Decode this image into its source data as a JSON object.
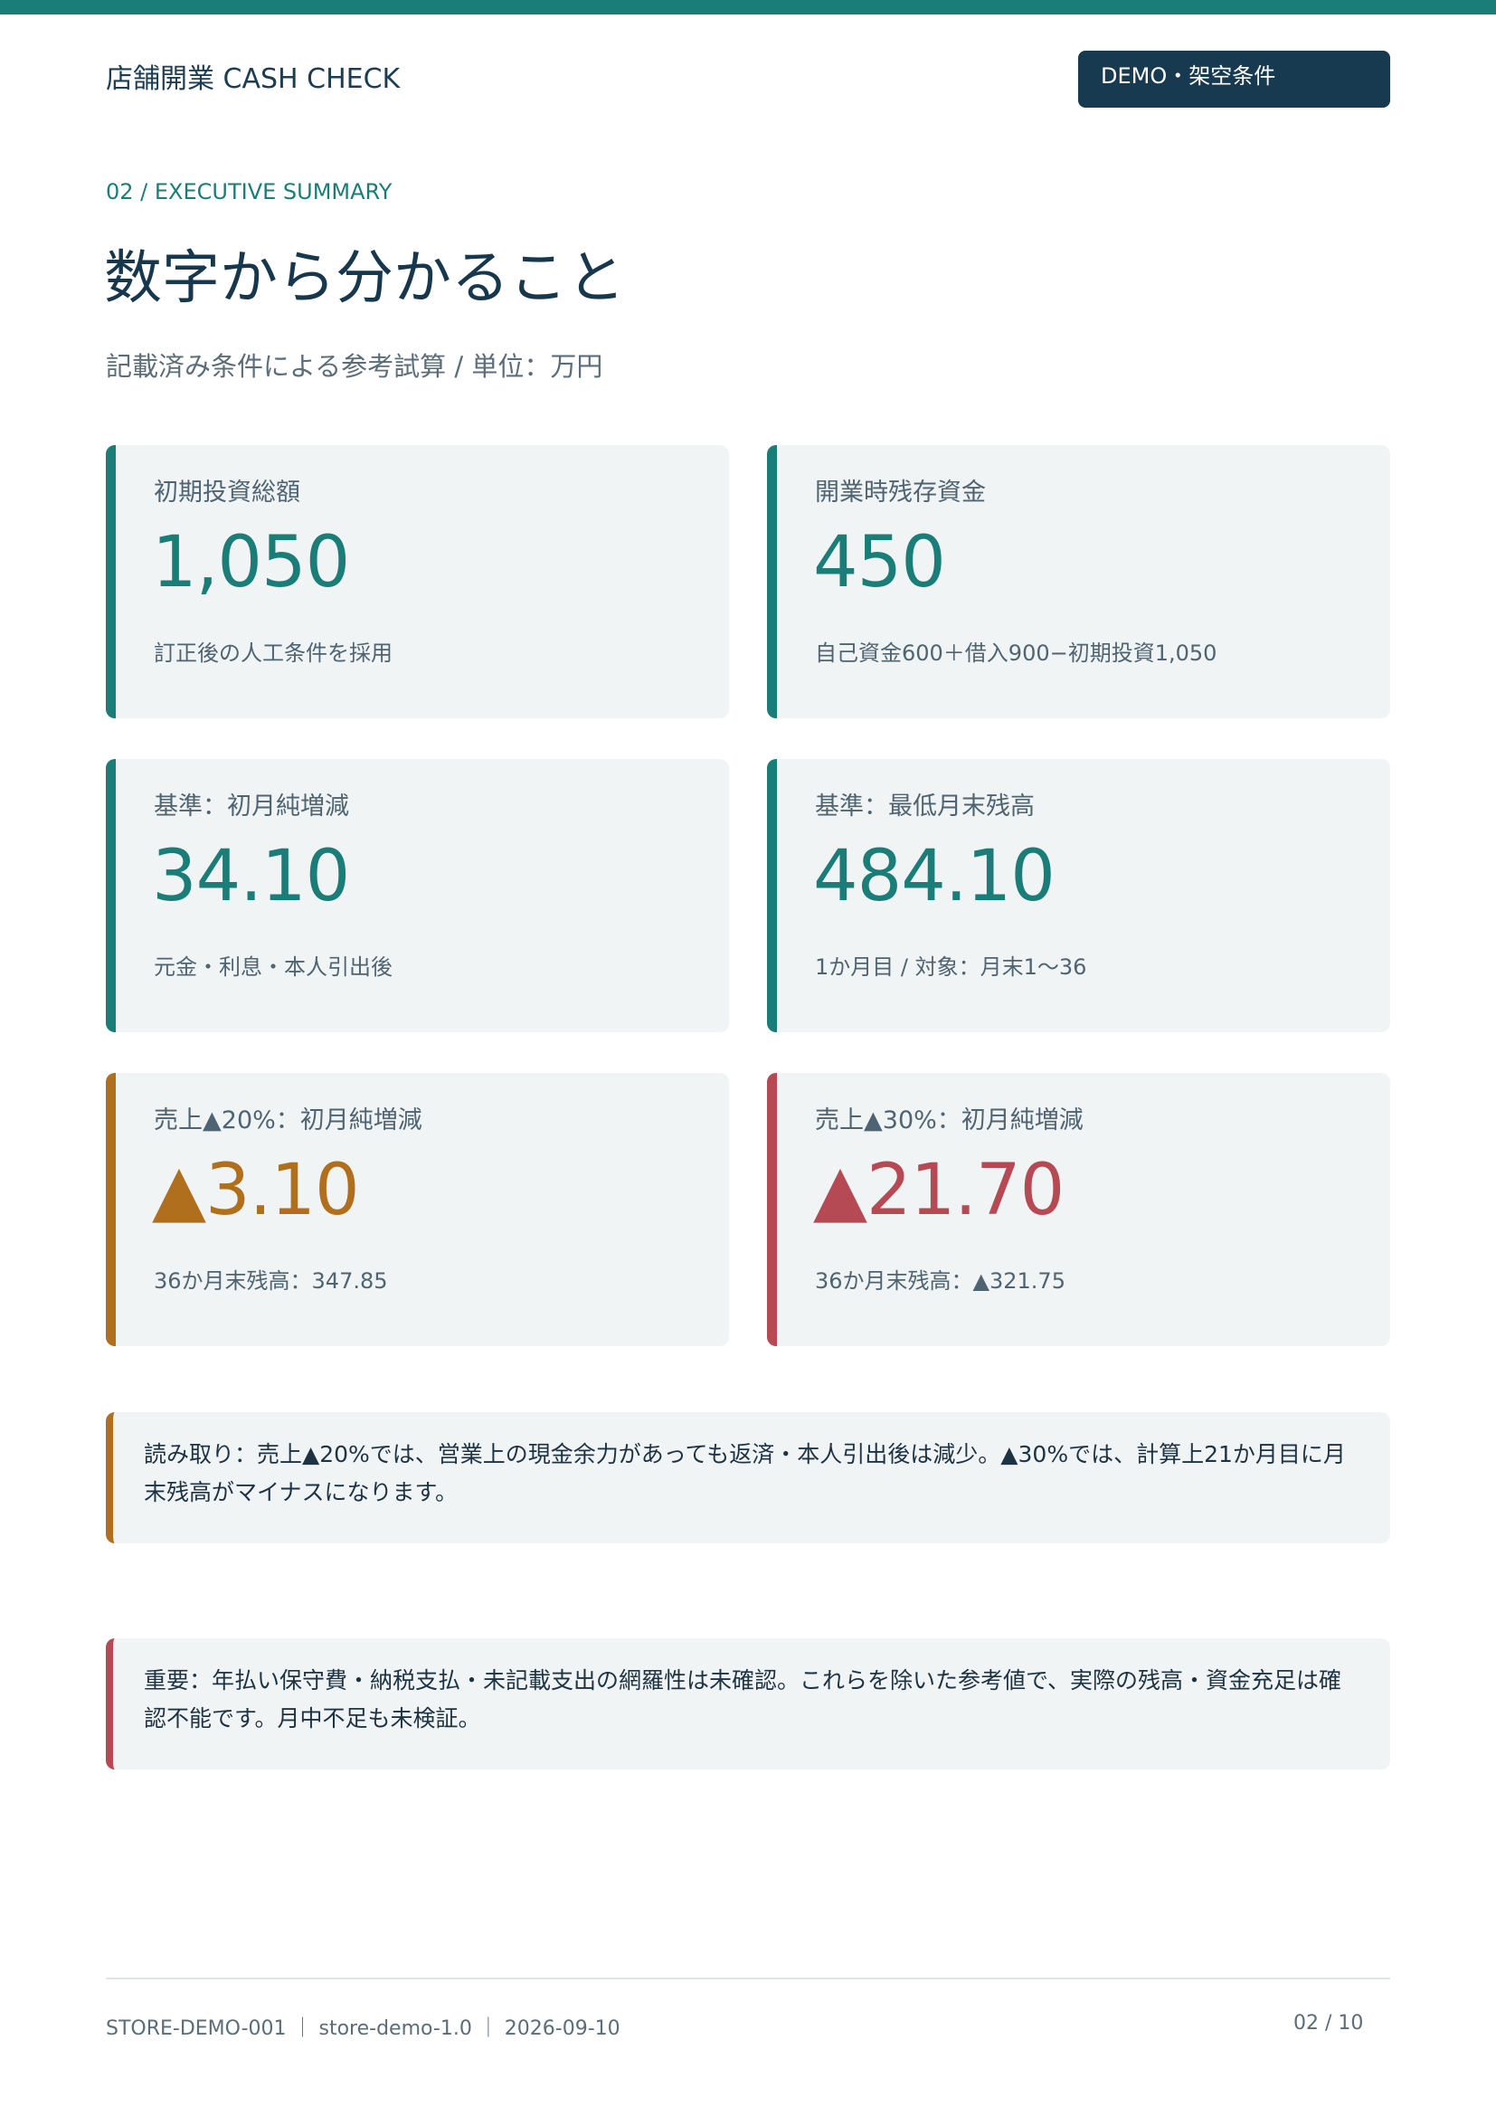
{
  "header": {
    "brand": "店舗開業 CASH CHECK",
    "badge": "DEMO・架空条件"
  },
  "section": {
    "eyebrow": "02 / EXECUTIVE SUMMARY",
    "title": "数字から分かること",
    "subtitle": "記載済み条件による参考試算 / 単位：万円"
  },
  "cards": [
    {
      "label": "初期投資総額",
      "value": "1,050",
      "note": "訂正後の人工条件を採用"
    },
    {
      "label": "開業時残存資金",
      "value": "450",
      "note": "自己資金600＋借入900−初期投資1,050"
    },
    {
      "label": "基準：初月純増減",
      "value": "34.10",
      "note": "元金・利息・本人引出後"
    },
    {
      "label": "基準：最低月末残高",
      "value": "484.10",
      "note": "1か月目 / 対象：月末1〜36"
    },
    {
      "label": "売上▲20%：初月純増減",
      "value": "▲3.10",
      "note": "36か月末残高：347.85"
    },
    {
      "label": "売上▲30%：初月純増減",
      "value": "▲21.70",
      "note": "36か月末残高：▲321.75"
    }
  ],
  "colors": {
    "teal": "#1b7d78",
    "amber": "#b06f1d",
    "red": "#b54a55",
    "navy": "#183a50"
  },
  "callouts": {
    "reading": "読み取り：売上▲20%では、営業上の現金余力があっても返済・本人引出後は減少。▲30%では、計算上21か月目に月末残高がマイナスになります。",
    "important": "重要：年払い保守費・納税支払・未記載支出の網羅性は未確認。これらを除いた参考値で、実際の残高・資金充足は確認不能です。月中不足も未検証。"
  },
  "footer": {
    "meta": "STORE-DEMO-001 ｜ store-demo-1.0 ｜ 2026-09-10",
    "page": "02 / 10"
  }
}
